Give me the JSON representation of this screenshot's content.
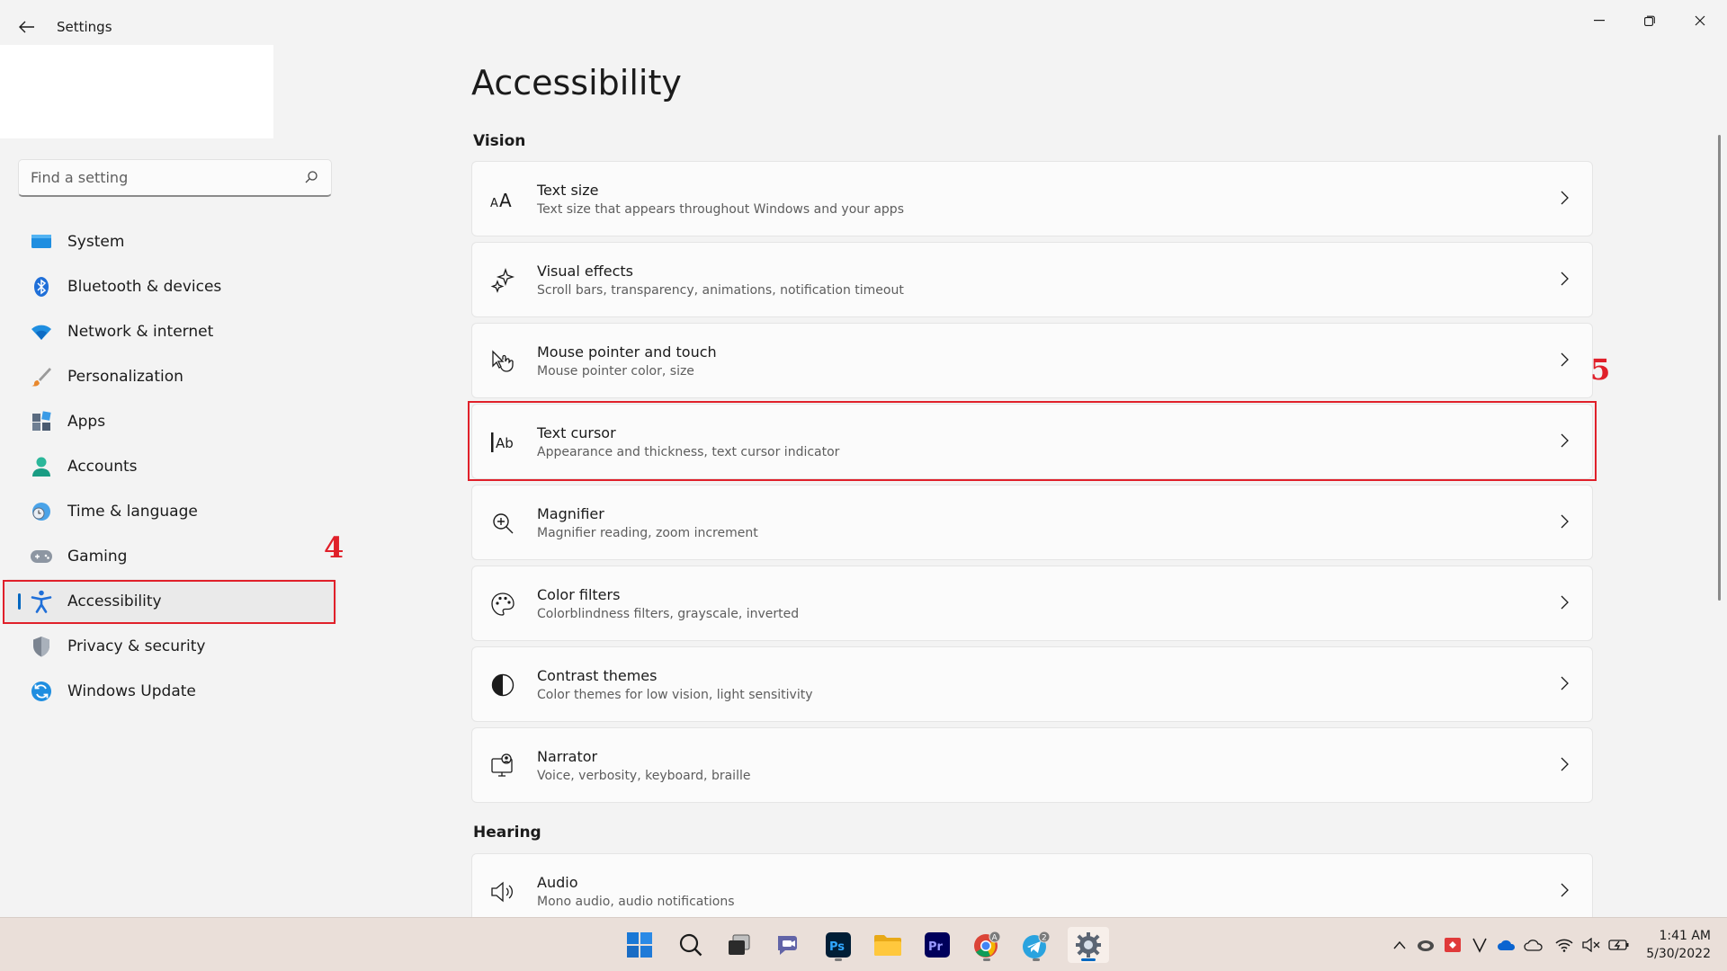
{
  "window": {
    "title": "Settings"
  },
  "sidebar": {
    "search_placeholder": "Find a setting",
    "items": [
      {
        "label": "System",
        "icon": "system-icon"
      },
      {
        "label": "Bluetooth & devices",
        "icon": "bluetooth-icon"
      },
      {
        "label": "Network & internet",
        "icon": "wifi-icon"
      },
      {
        "label": "Personalization",
        "icon": "brush-icon"
      },
      {
        "label": "Apps",
        "icon": "apps-icon"
      },
      {
        "label": "Accounts",
        "icon": "person-icon"
      },
      {
        "label": "Time & language",
        "icon": "clock-globe-icon"
      },
      {
        "label": "Gaming",
        "icon": "gamepad-icon"
      },
      {
        "label": "Accessibility",
        "icon": "accessibility-icon",
        "active": true
      },
      {
        "label": "Privacy & security",
        "icon": "shield-icon"
      },
      {
        "label": "Windows Update",
        "icon": "update-icon"
      }
    ]
  },
  "main": {
    "title": "Accessibility",
    "sections": {
      "vision": "Vision",
      "hearing": "Hearing"
    },
    "cards": [
      {
        "title": "Text size",
        "subtitle": "Text size that appears throughout Windows and your apps",
        "icon": "text-size-icon"
      },
      {
        "title": "Visual effects",
        "subtitle": "Scroll bars, transparency, animations, notification timeout",
        "icon": "sparkle-icon"
      },
      {
        "title": "Mouse pointer and touch",
        "subtitle": "Mouse pointer color, size",
        "icon": "pointer-touch-icon"
      },
      {
        "title": "Text cursor",
        "subtitle": "Appearance and thickness, text cursor indicator",
        "icon": "text-cursor-icon"
      },
      {
        "title": "Magnifier",
        "subtitle": "Magnifier reading, zoom increment",
        "icon": "magnifier-icon"
      },
      {
        "title": "Color filters",
        "subtitle": "Colorblindness filters, grayscale, inverted",
        "icon": "palette-icon"
      },
      {
        "title": "Contrast themes",
        "subtitle": "Color themes for low vision, light sensitivity",
        "icon": "contrast-icon"
      },
      {
        "title": "Narrator",
        "subtitle": "Voice, verbosity, keyboard, braille",
        "icon": "narrator-icon"
      }
    ],
    "hearing_cards": [
      {
        "title": "Audio",
        "subtitle": "Mono audio, audio notifications",
        "icon": "speaker-icon"
      }
    ]
  },
  "annotations": {
    "step4": "4",
    "step5": "5"
  },
  "taskbar": {
    "time": "1:41 AM",
    "date": "5/30/2022",
    "badges": {
      "chrome": "A",
      "telegram": "2"
    }
  },
  "colors": {
    "accent": "#0067c0",
    "annotation": "#e0202a"
  }
}
